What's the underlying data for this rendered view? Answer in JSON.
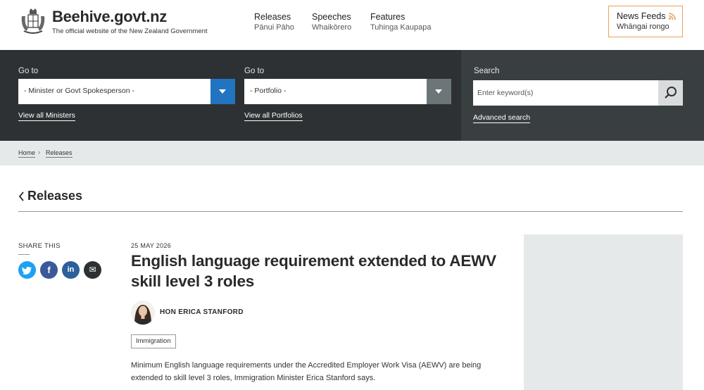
{
  "header": {
    "title": "Beehive.govt.nz",
    "tagline": "The official website of the New Zealand Government",
    "nav": [
      {
        "label": "Releases",
        "sub": "Pānui Pāho"
      },
      {
        "label": "Speeches",
        "sub": "Whaikōrero"
      },
      {
        "label": "Features",
        "sub": "Tuhinga Kaupapa"
      }
    ],
    "feeds": {
      "label": "News Feeds",
      "sub": "Whāngai rongo"
    }
  },
  "search_band": {
    "goto_label": "Go to",
    "minister_select": "- Minister or Govt Spokesperson -",
    "portfolio_select": "- Portfolio -",
    "view_ministers": "View all Ministers",
    "view_portfolios": "View all Portfolios",
    "search_label": "Search",
    "search_placeholder": "Enter keyword(s)",
    "advanced_search": "Advanced search"
  },
  "breadcrumb": {
    "home": "Home",
    "sep": "›",
    "current": "Releases"
  },
  "section": {
    "title": "Releases"
  },
  "share": {
    "label": "SHARE THIS",
    "buttons": [
      {
        "icon": "twitter-icon",
        "glyph": "t",
        "color": "#1da1f2"
      },
      {
        "icon": "facebook-icon",
        "glyph": "f",
        "color": "#3b5998"
      },
      {
        "icon": "linkedin-icon",
        "glyph": "in",
        "color": "#2d5f9a"
      },
      {
        "icon": "email-icon",
        "glyph": "✉",
        "color": "#2d3133"
      }
    ]
  },
  "article": {
    "date": "25 MAY 2026",
    "title": "English language requirement extended to AEWV skill level 3 roles",
    "minister": "HON ERICA STANFORD",
    "tag": "Immigration",
    "body": "Minimum English language requirements under the Accredited Employer Work Visa (AEWV) are being extended to skill level 3 roles, Immigration Minister Erica Stanford says."
  },
  "colors": {
    "accent_blue": "#2174c0",
    "dark_band": "#2d3133",
    "feed_orange": "#e8a35c"
  }
}
